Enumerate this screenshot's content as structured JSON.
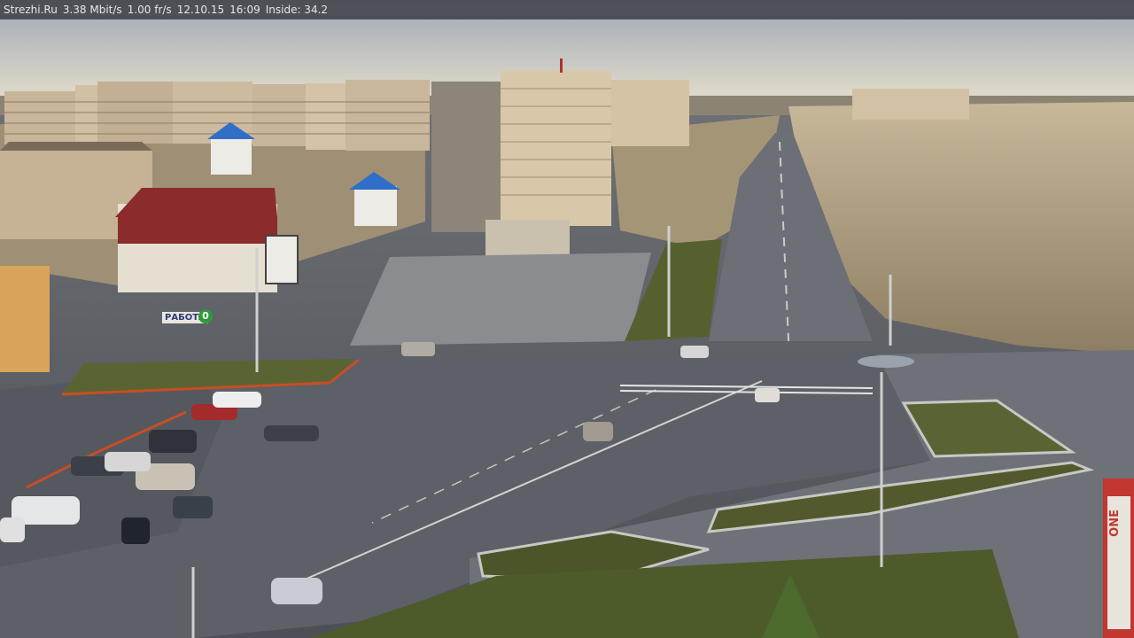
{
  "overlay": {
    "site": "Strezhi.Ru",
    "bitrate": "3.38 Mbit/s",
    "framerate": "1.00 fr/s",
    "date": "12.10.15",
    "time": "16:09",
    "inside": "Inside: 34.2"
  },
  "signs": {
    "store": "ONE",
    "billboard": "РАБОТА",
    "ad_number": "0"
  },
  "colors": {
    "sky_top": "#a9b3c0",
    "sky_horizon": "#dcd8c8",
    "asphalt": "#5e6167",
    "square": "#7a7d83",
    "building_beige": "#c9b9a0",
    "red_roof": "#8c2b2b",
    "blue_roof": "#2f6fc7",
    "grass": "#4f5a2a",
    "tree_bare": "#b7a88e"
  }
}
